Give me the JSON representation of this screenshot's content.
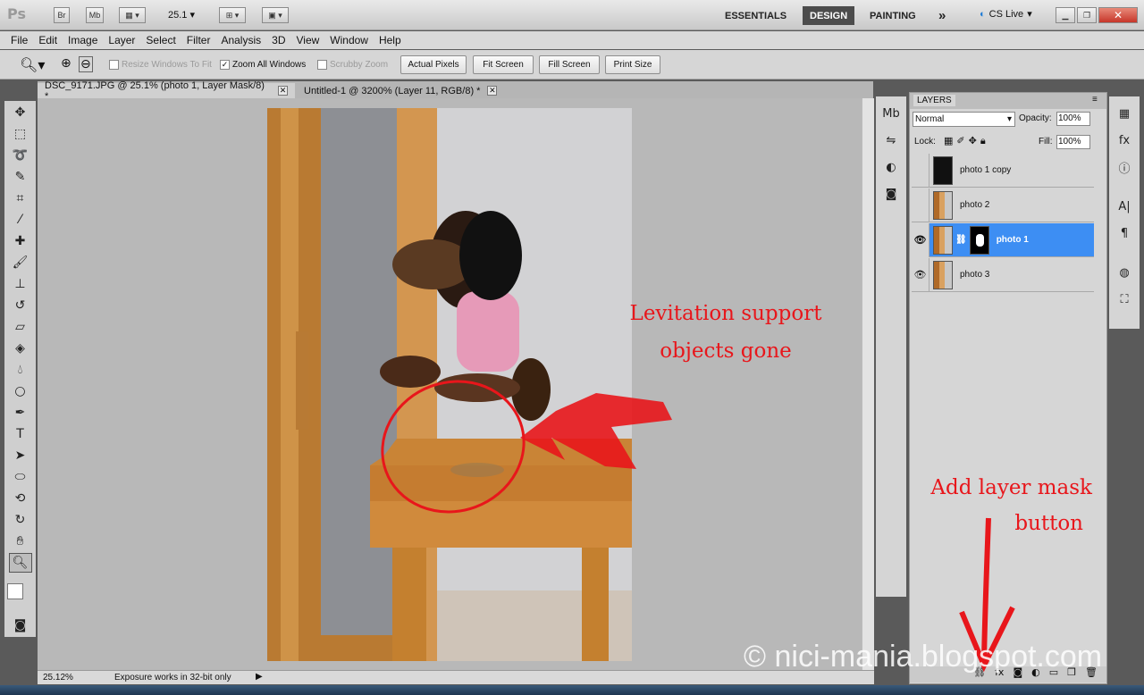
{
  "app": {
    "logo": "Ps"
  },
  "appbar": {
    "bridge": "Br",
    "minibridge": "Mb",
    "zoom": "25.1",
    "workspaces": [
      "ESSENTIALS",
      "DESIGN",
      "PAINTING"
    ],
    "overflow": "»",
    "cs_live": "CS Live"
  },
  "menubar": [
    "File",
    "Edit",
    "Image",
    "Layer",
    "Select",
    "Filter",
    "Analysis",
    "3D",
    "View",
    "Window",
    "Help"
  ],
  "options": {
    "resize_windows": "Resize Windows To Fit",
    "zoom_all": "Zoom All Windows",
    "scrubby": "Scrubby Zoom",
    "buttons": [
      "Actual Pixels",
      "Fit Screen",
      "Fill Screen",
      "Print Size"
    ]
  },
  "tabs": [
    {
      "label": "DSC_9171.JPG @ 25.1% (photo 1, Layer Mask/8) *"
    },
    {
      "label": "Untitled-1 @ 3200% (Layer 11, RGB/8) *"
    }
  ],
  "status": {
    "zoom": "25.12%",
    "info": "Exposure works in 32-bit only"
  },
  "layers_panel": {
    "title": "LAYERS",
    "blend_mode": "Normal",
    "opacity_label": "Opacity:",
    "opacity": "100%",
    "lock_label": "Lock:",
    "fill_label": "Fill:",
    "fill": "100%",
    "layers": [
      {
        "name": "photo 1 copy",
        "visible": false,
        "selected": false
      },
      {
        "name": "photo 2",
        "visible": false,
        "selected": false
      },
      {
        "name": "photo 1",
        "visible": true,
        "selected": true
      },
      {
        "name": "photo 3",
        "visible": true,
        "selected": false
      }
    ]
  },
  "annotations": {
    "levitation_line1": "Levitation support",
    "levitation_line2": "objects gone",
    "mask_line1": "Add layer mask",
    "mask_line2": "button"
  },
  "watermark": "© nici-mania.blogspot.com",
  "colors": {
    "annotation": "#e8161b",
    "selection": "#3d8ef3"
  }
}
